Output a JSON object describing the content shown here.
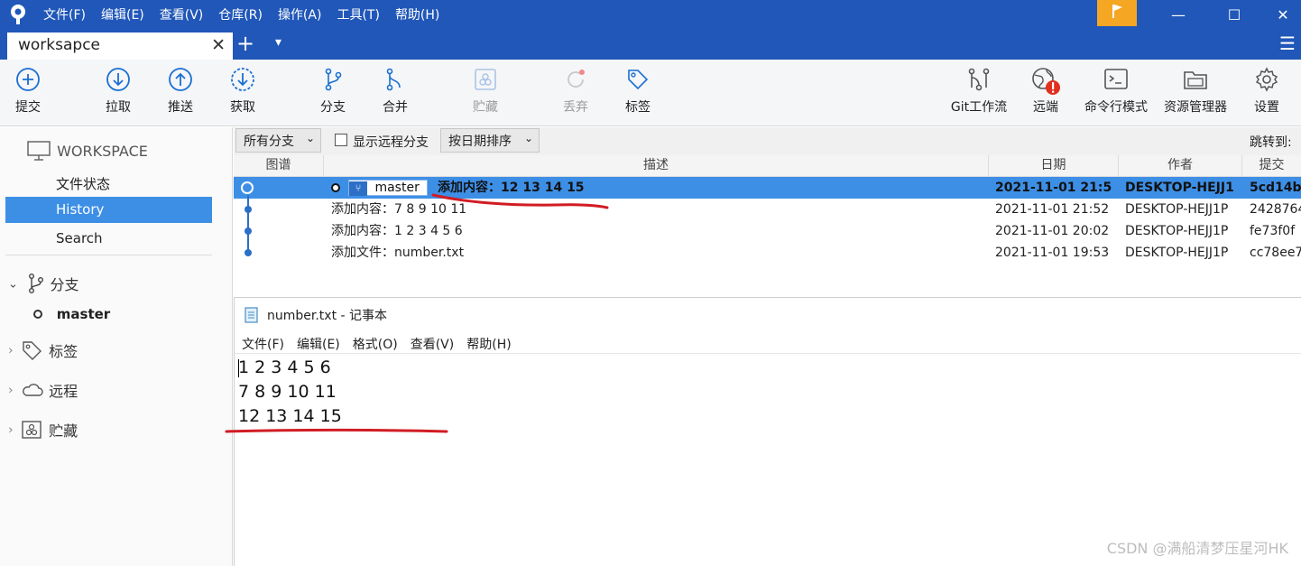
{
  "titlebar": {
    "menu": [
      "文件(F)",
      "编辑(E)",
      "查看(V)",
      "仓库(R)",
      "操作(A)",
      "工具(T)",
      "帮助(H)"
    ],
    "window_buttons": {
      "minimize": "—",
      "maximize": "☐",
      "close": "✕"
    }
  },
  "tabs": {
    "active": "workspace_tab",
    "workspace_tab": "worksapce",
    "add": "+",
    "more": "▾",
    "hamburger": "☰"
  },
  "toolbar": {
    "commit": "提交",
    "pull": "拉取",
    "push": "推送",
    "fetch": "获取",
    "branch": "分支",
    "merge": "合并",
    "stash": "贮藏",
    "discard": "丢弃",
    "tag": "标签",
    "gitflow": "Git工作流",
    "remote": "远端",
    "terminal": "命令行模式",
    "explorer": "资源管理器",
    "settings": "设置"
  },
  "sidebar": {
    "workspace": "WORKSPACE",
    "workspace_items": [
      "文件状态",
      "History",
      "Search"
    ],
    "branches": "分支",
    "branch_current": "master",
    "tags": "标签",
    "remotes": "远程",
    "stashes": "贮藏"
  },
  "filter": {
    "branches": "所有分支",
    "show_remote": "显示远程分支",
    "sort": "按日期排序",
    "jump": "跳转到:"
  },
  "table": {
    "headers": [
      "图谱",
      "描述",
      "日期",
      "作者",
      "提交"
    ],
    "rows": [
      {
        "branch_badge": "master",
        "desc": "添加内容：12 13 14 15",
        "date": "2021-11-01 21:5",
        "author": "DESKTOP-HEJJ1",
        "commit": "5cd14b",
        "selected": true
      },
      {
        "desc": "添加内容：7 8 9 10 11",
        "date": "2021-11-01 21:52",
        "author": "DESKTOP-HEJJ1P",
        "commit": "2428764"
      },
      {
        "desc": "添加内容：1 2 3 4 5 6",
        "date": "2021-11-01 20:02",
        "author": "DESKTOP-HEJJ1P",
        "commit": "fe73f0f"
      },
      {
        "desc": "添加文件：number.txt",
        "date": "2021-11-01 19:53",
        "author": "DESKTOP-HEJJ1P",
        "commit": "cc78ee7"
      }
    ]
  },
  "notepad": {
    "title": "number.txt - 记事本",
    "menu": [
      "文件(F)",
      "编辑(E)",
      "格式(O)",
      "查看(V)",
      "帮助(H)"
    ],
    "lines": [
      "1 2 3 4 5 6",
      "7 8 9 10 11",
      "12 13 14 15"
    ]
  },
  "watermark": "CSDN @满船清梦压星河HK",
  "colors": {
    "titlebar": "#2057b8",
    "selected_row": "#3d8fe6",
    "accent": "#1a6fd1",
    "annotation": "#d11c24",
    "flag": "#f5a623"
  }
}
